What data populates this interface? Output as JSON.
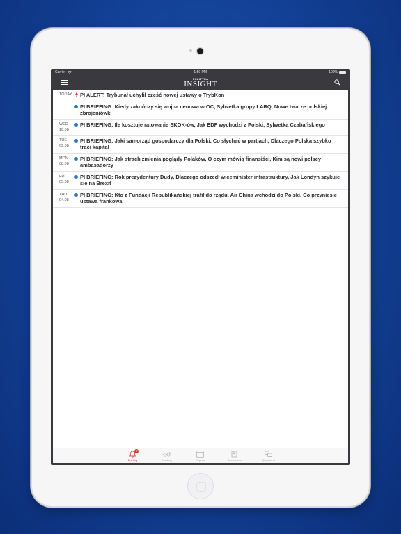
{
  "status_bar": {
    "carrier": "Carrier",
    "time": "1:59 PM",
    "battery": "100%"
  },
  "header": {
    "logo_small": "POLITYKA",
    "logo_big": "INSIGHT"
  },
  "feed": [
    {
      "day": "TODAY",
      "date": "",
      "items": [
        {
          "type": "alert",
          "text": "PI ALERT: Trybunał uchylił część nowej ustawy o TrybKon"
        },
        {
          "type": "briefing",
          "text": "PI BRIEFING: Kiedy zakończy się wojna cenowa w OC, Sylwetka grupy LARQ, Nowe twarze polskiej zbrojeniówki"
        }
      ]
    },
    {
      "day": "WED",
      "date": "10.08",
      "items": [
        {
          "type": "briefing",
          "text": "PI BRIEFING: Ile kosztuje ratowanie SKOK-ów, Jak EDF wychodzi z Polski, Sylwetka Czabańskiego"
        }
      ]
    },
    {
      "day": "TUE",
      "date": "09.08",
      "items": [
        {
          "type": "briefing",
          "text": "PI BRIEFING: Jaki samorząd gospodarczy dla Polski, Co słychać w partiach, Dlaczego Polska szybko traci kapitał"
        }
      ]
    },
    {
      "day": "MON",
      "date": "08.08",
      "items": [
        {
          "type": "briefing",
          "text": "PI BRIEFING: Jak strach zmienia poglądy Polaków, O czym mówią finansiści, Kim są nowi polscy ambasadorzy"
        }
      ]
    },
    {
      "day": "FRI",
      "date": "05.08",
      "items": [
        {
          "type": "briefing",
          "text": "PI BRIEFING: Rok prezydentury Dudy, Dlaczego odszedł wiceminister infrastruktury, Jak Londyn szykuje się na Brexit"
        }
      ]
    },
    {
      "day": "THU",
      "date": "04.08",
      "items": [
        {
          "type": "briefing",
          "text": "PI BRIEFING: Kto z Fundacji Republikańskiej trafił do rządu, Air China wchodzi do Polski, Co przyniesie ustawa frankowa"
        }
      ]
    }
  ],
  "tabs": [
    {
      "label": "Briefing",
      "icon": "bell-icon",
      "badge": "7",
      "active": true
    },
    {
      "label": "Reading",
      "icon": "glasses-icon",
      "badge": "",
      "active": false
    },
    {
      "label": "Reports",
      "icon": "book-icon",
      "badge": "",
      "active": false
    },
    {
      "label": "Bookmarks",
      "icon": "bookmark-icon",
      "badge": "",
      "active": false
    },
    {
      "label": "Questions",
      "icon": "chat-icon",
      "badge": "",
      "active": false
    }
  ],
  "colors": {
    "accent_alert": "#d9362f",
    "briefing_dot": "#2a7ac4",
    "header_bg": "#3a3a3e"
  }
}
